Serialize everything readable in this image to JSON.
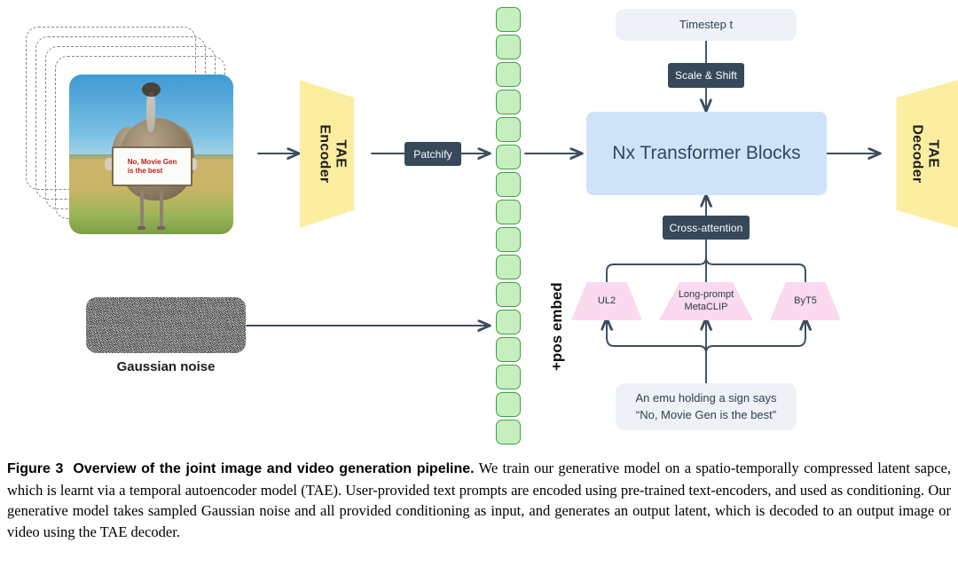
{
  "figure": {
    "input_stack": {
      "name": "input video frames",
      "ghost_count": 4,
      "photo": {
        "alt": "An emu standing in a grassy field holding a white sign",
        "sign_line1": "No,  Movie  Gen",
        "sign_line2": "is the best"
      }
    },
    "noise": {
      "label": "Gaussian noise"
    },
    "tae_encoder": {
      "line1": "TAE",
      "line2": "Encoder"
    },
    "patchify": {
      "label": "Patchify"
    },
    "latent_tokens": {
      "count": 16,
      "label": "latent token sequence",
      "color": "#c6efc0",
      "border": "#3fa13f"
    },
    "pos_embed": {
      "label": "+pos embed"
    },
    "timestep": {
      "label": "Timestep t"
    },
    "scale_shift": {
      "label": "Scale & Shift"
    },
    "transformer": {
      "label": "Nx Transformer Blocks",
      "color": "#cfe2f7"
    },
    "tae_decoder": {
      "line1": "TAE",
      "line2": "Decoder"
    },
    "cross_attention": {
      "label": "Cross-attention"
    },
    "text_encoders": [
      {
        "label": "UL2",
        "lines": [
          "UL2"
        ]
      },
      {
        "label": "Long-prompt MetaCLIP",
        "lines": [
          "Long-prompt",
          "MetaCLIP"
        ]
      },
      {
        "label": "ByT5",
        "lines": [
          "ByT5"
        ]
      }
    ],
    "prompt": {
      "line1": "An emu holding a sign says",
      "line2": "“No, Movie Gen is the best”"
    },
    "colors": {
      "tae_yellow": "#fbeea0",
      "badge_slate": "#36485a",
      "pill_gray": "#eef2f6",
      "transformer_blue": "#cfe2f7",
      "encoder_pink": "#fbd9ef",
      "token_green": "#c6efc0",
      "stroke": "#3b4d5e"
    }
  },
  "caption": {
    "figure_label": "Figure 3",
    "title": "Overview of the joint image and video generation pipeline.",
    "body": "We train our generative model on a spatio-temporally compressed latent sapce, which is learnt via a temporal autoencoder model (TAE). User-provided text prompts are encoded using pre-trained text-encoders, and used as conditioning. Our generative model takes sampled Gaussian noise and all provided conditioning as input, and generates an output latent, which is decoded to an output image or video using the TAE decoder."
  }
}
